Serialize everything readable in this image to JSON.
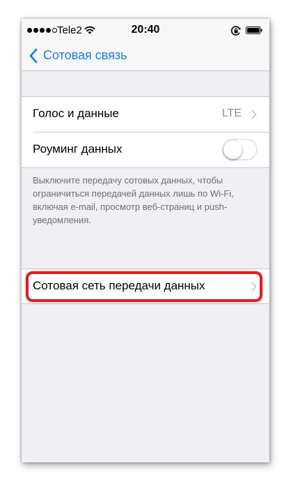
{
  "status_bar": {
    "carrier": "Tele2",
    "time": "20:40",
    "signal_strength": 4,
    "signal_max": 5,
    "icons": [
      "wifi-icon",
      "rotation-lock-icon",
      "battery-icon"
    ]
  },
  "nav": {
    "back_label": "Сотовая связь",
    "back_icon": "chevron-left-icon",
    "accent_color": "#1a7ce6"
  },
  "settings": {
    "voice_data": {
      "label": "Голос и данные",
      "value": "LTE"
    },
    "data_roaming": {
      "label": "Роуминг данных",
      "enabled": false
    },
    "footer_note": "Выключите передачу сотовых данных, чтобы ограничиться передачей данных лишь по Wi-Fi, включая e-mail, просмотр веб-страниц и push-уведомления.",
    "cellular_data_network": {
      "label": "Сотовая сеть передачи данных",
      "highlighted": true,
      "highlight_color": "#e11d23"
    }
  }
}
